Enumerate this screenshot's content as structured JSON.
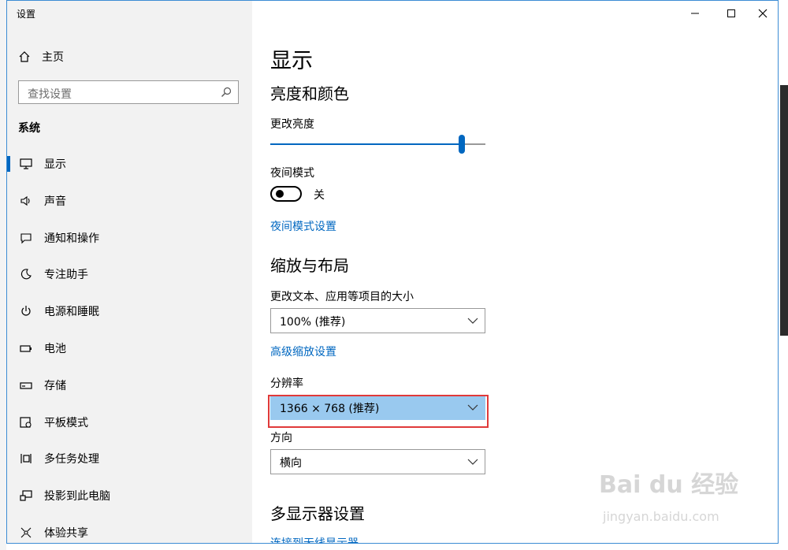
{
  "window": {
    "title": "设置"
  },
  "sidebar": {
    "home_label": "主页",
    "search_placeholder": "查找设置",
    "section_title": "系统",
    "items": [
      {
        "label": "显示",
        "icon": "monitor-icon",
        "active": true
      },
      {
        "label": "声音",
        "icon": "speaker-icon"
      },
      {
        "label": "通知和操作",
        "icon": "notification-icon"
      },
      {
        "label": "专注助手",
        "icon": "moon-icon"
      },
      {
        "label": "电源和睡眠",
        "icon": "power-icon"
      },
      {
        "label": "电池",
        "icon": "battery-icon"
      },
      {
        "label": "存储",
        "icon": "storage-icon"
      },
      {
        "label": "平板模式",
        "icon": "tablet-icon"
      },
      {
        "label": "多任务处理",
        "icon": "multitask-icon"
      },
      {
        "label": "投影到此电脑",
        "icon": "project-icon"
      },
      {
        "label": "体验共享",
        "icon": "share-icon"
      }
    ]
  },
  "content": {
    "page_title": "显示",
    "brightness_section": "亮度和颜色",
    "brightness_label": "更改亮度",
    "brightness_level_percent": 89,
    "night_mode_label": "夜间模式",
    "night_mode_state": "关",
    "night_mode_settings_link": "夜间模式设置",
    "scale_section": "缩放与布局",
    "scale_label": "更改文本、应用等项目的大小",
    "scale_value": "100% (推荐)",
    "advanced_scale_link": "高级缩放设置",
    "resolution_label": "分辨率",
    "resolution_value": "1366 × 768 (推荐)",
    "orientation_label": "方向",
    "orientation_value": "横向",
    "multi_display_section": "多显示器设置",
    "wireless_display_link": "连接到无线显示器"
  },
  "watermark": {
    "text": "Bai du 经验",
    "url": "jingyan.baidu.com"
  },
  "colors": {
    "accent": "#0067c0",
    "highlight": "#e03a3a",
    "selected_bg": "#99c9ef"
  }
}
